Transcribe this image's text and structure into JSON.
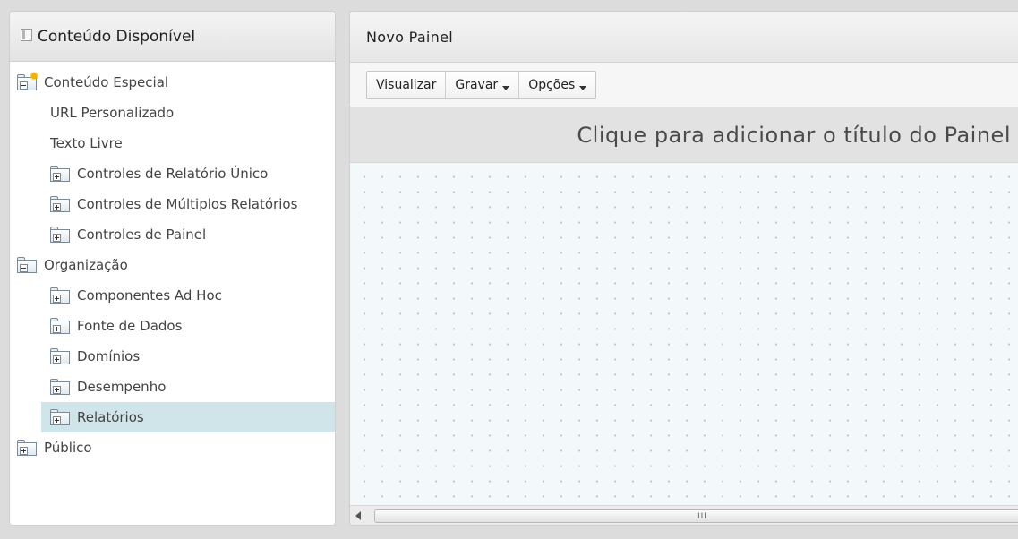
{
  "left_panel": {
    "title": "Conteúdo Disponível",
    "tree": [
      {
        "label": "Conteúdo Especial",
        "icon": "special-folder-icon",
        "expanded": true
      },
      {
        "label": "URL Personalizado"
      },
      {
        "label": "Texto Livre"
      },
      {
        "label": "Controles de Relatório Único",
        "icon": "folder-plus-icon"
      },
      {
        "label": "Controles de Múltiplos Relatórios",
        "icon": "folder-plus-icon"
      },
      {
        "label": "Controles de Painel",
        "icon": "folder-plus-icon"
      },
      {
        "label": "Organização",
        "icon": "folder-minus-icon",
        "expanded": true
      },
      {
        "label": "Componentes Ad Hoc",
        "icon": "folder-plus-icon"
      },
      {
        "label": "Fonte de Dados",
        "icon": "folder-plus-icon"
      },
      {
        "label": "Domínios",
        "icon": "folder-plus-icon"
      },
      {
        "label": "Desempenho",
        "icon": "folder-plus-icon"
      },
      {
        "label": "Relatórios",
        "icon": "folder-plus-icon",
        "selected": true
      },
      {
        "label": "Público",
        "icon": "folder-plus-icon"
      }
    ]
  },
  "right_panel": {
    "title": "Novo Painel",
    "toolbar": {
      "visualizar": "Visualizar",
      "gravar": "Gravar",
      "opcoes": "Opções"
    },
    "dashboard_title_placeholder": "Clique para adicionar o título do Painel",
    "scrollbar_grip": "III"
  },
  "colors": {
    "selected_row": "#cfe5ea",
    "canvas_background": "#f3f8fa",
    "title_bar": "#e2e2e2"
  }
}
